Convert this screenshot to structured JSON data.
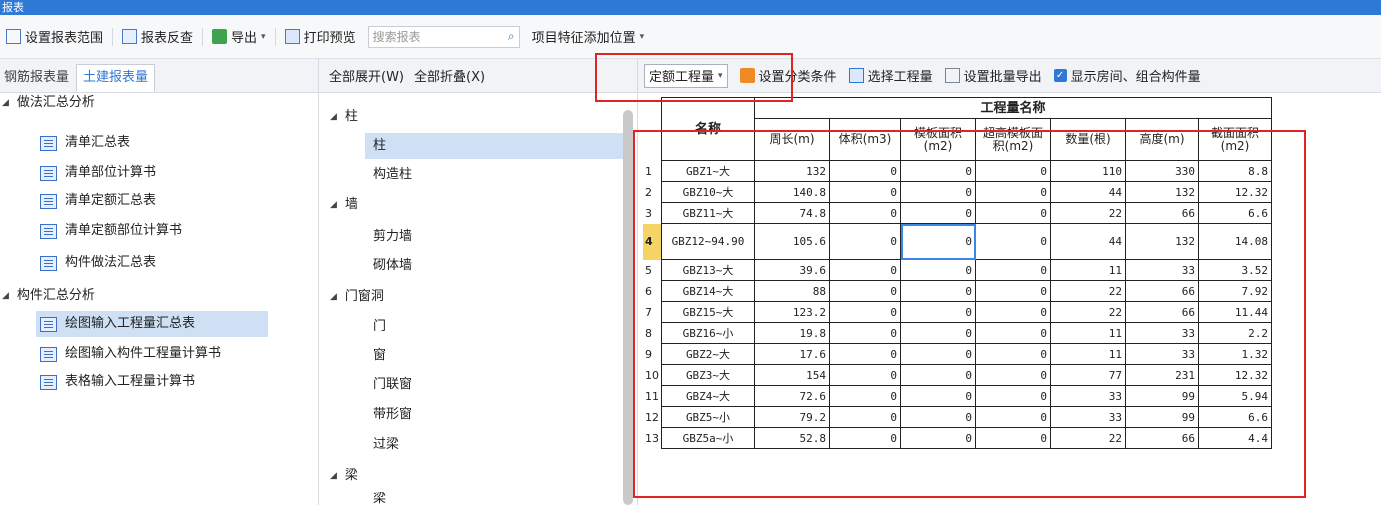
{
  "window": {
    "title": "报表"
  },
  "toolbar": {
    "set_range": "设置报表范围",
    "reverse_check": "报表反查",
    "export": "导出",
    "print_preview": "打印预览",
    "search_placeholder": "搜索报表",
    "feature_position": "项目特征添加位置"
  },
  "left": {
    "tabs": [
      "钢筋报表量",
      "土建报表量"
    ],
    "active_tab": 1,
    "groups": [
      {
        "label": "做法汇总分析",
        "items": [
          "清单汇总表",
          "清单部位计算书",
          "清单定额汇总表",
          "清单定额部位计算书",
          "构件做法汇总表"
        ]
      },
      {
        "label": "构件汇总分析",
        "items": [
          "绘图输入工程量汇总表",
          "绘图输入构件工程量计算书",
          "表格输入工程量计算书"
        ]
      }
    ]
  },
  "middle": {
    "expand_all": "全部展开(W)",
    "collapse_all": "全部折叠(X)",
    "groups": [
      {
        "label": "柱",
        "items": [
          "柱",
          "构造柱"
        ]
      },
      {
        "label": "墙",
        "items": [
          "剪力墙",
          "砌体墙"
        ]
      },
      {
        "label": "门窗洞",
        "items": [
          "门",
          "窗",
          "门联窗",
          "带形窗",
          "过梁"
        ]
      },
      {
        "label": "梁",
        "items": [
          "梁"
        ]
      }
    ]
  },
  "right": {
    "quantity_type": "定额工程量",
    "set_category": "设置分类条件",
    "select_project": "选择工程量",
    "batch_export": "设置批量导出",
    "show_rooms": "显示房间、组合构件量"
  },
  "table": {
    "group_header": "工程量名称",
    "name_header": "名称",
    "columns": [
      "周长(m)",
      "体积(m3)",
      "模板面积(m2)",
      "超高模板面积(m2)",
      "数量(根)",
      "高度(m)",
      "截面面积(m2)"
    ],
    "rows": [
      {
        "idx": "1",
        "name": "GBZ1~大",
        "values": [
          "132",
          "0",
          "0",
          "0",
          "110",
          "330",
          "8.8"
        ]
      },
      {
        "idx": "2",
        "name": "GBZ10~大",
        "values": [
          "140.8",
          "0",
          "0",
          "0",
          "44",
          "132",
          "12.32"
        ]
      },
      {
        "idx": "3",
        "name": "GBZ11~大",
        "values": [
          "74.8",
          "0",
          "0",
          "0",
          "22",
          "66",
          "6.6"
        ]
      },
      {
        "idx": "4",
        "name": "GBZ12~94.90",
        "values": [
          "105.6",
          "0",
          "0",
          "0",
          "44",
          "132",
          "14.08"
        ]
      },
      {
        "idx": "5",
        "name": "GBZ13~大",
        "values": [
          "39.6",
          "0",
          "0",
          "0",
          "11",
          "33",
          "3.52"
        ]
      },
      {
        "idx": "6",
        "name": "GBZ14~大",
        "values": [
          "88",
          "0",
          "0",
          "0",
          "22",
          "66",
          "7.92"
        ]
      },
      {
        "idx": "7",
        "name": "GBZ15~大",
        "values": [
          "123.2",
          "0",
          "0",
          "0",
          "22",
          "66",
          "11.44"
        ]
      },
      {
        "idx": "8",
        "name": "GBZ16~小",
        "values": [
          "19.8",
          "0",
          "0",
          "0",
          "11",
          "33",
          "2.2"
        ]
      },
      {
        "idx": "9",
        "name": "GBZ2~大",
        "values": [
          "17.6",
          "0",
          "0",
          "0",
          "11",
          "33",
          "1.32"
        ]
      },
      {
        "idx": "10",
        "name": "GBZ3~大",
        "values": [
          "154",
          "0",
          "0",
          "0",
          "77",
          "231",
          "12.32"
        ]
      },
      {
        "idx": "11",
        "name": "GBZ4~大",
        "values": [
          "72.6",
          "0",
          "0",
          "0",
          "33",
          "99",
          "5.94"
        ]
      },
      {
        "idx": "12",
        "name": "GBZ5~小",
        "values": [
          "79.2",
          "0",
          "0",
          "0",
          "33",
          "99",
          "6.6"
        ]
      },
      {
        "idx": "13",
        "name": "GBZ5a~小",
        "values": [
          "52.8",
          "0",
          "0",
          "0",
          "22",
          "66",
          "4.4"
        ]
      }
    ]
  },
  "colors": {
    "accent": "#2f79d6",
    "annotation": "#e02424",
    "selection": "#cfe0f5"
  }
}
